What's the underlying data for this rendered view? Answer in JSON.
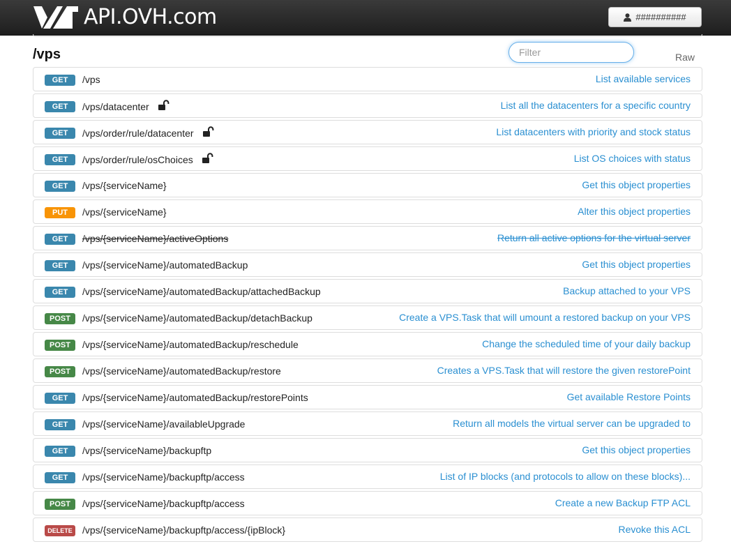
{
  "header": {
    "logo_text": "API.OVH.com",
    "user_label": "##########",
    "colors": {
      "bar": "#2b2b2b",
      "logo_text": "#ffffff"
    }
  },
  "section": {
    "title": "/vps",
    "filter_placeholder": "Filter",
    "raw_label": "Raw"
  },
  "method_colors": {
    "GET": "#3a87ad",
    "PUT": "#f89406",
    "POST": "#468847",
    "DELETE": "#b94a48"
  },
  "operations": [
    {
      "method": "GET",
      "path": "/vps",
      "description": "List available services",
      "lock": false,
      "deprecated": false
    },
    {
      "method": "GET",
      "path": "/vps/datacenter",
      "description": "List all the datacenters for a specific country",
      "lock": true,
      "deprecated": false
    },
    {
      "method": "GET",
      "path": "/vps/order/rule/datacenter",
      "description": "List datacenters with priority and stock status",
      "lock": true,
      "deprecated": false
    },
    {
      "method": "GET",
      "path": "/vps/order/rule/osChoices",
      "description": "List OS choices with status",
      "lock": true,
      "deprecated": false
    },
    {
      "method": "GET",
      "path": "/vps/{serviceName}",
      "description": "Get this object properties",
      "lock": false,
      "deprecated": false
    },
    {
      "method": "PUT",
      "path": "/vps/{serviceName}",
      "description": "Alter this object properties",
      "lock": false,
      "deprecated": false
    },
    {
      "method": "GET",
      "path": "/vps/{serviceName}/activeOptions",
      "description": "Return all active options for the virtual server",
      "lock": false,
      "deprecated": true
    },
    {
      "method": "GET",
      "path": "/vps/{serviceName}/automatedBackup",
      "description": "Get this object properties",
      "lock": false,
      "deprecated": false
    },
    {
      "method": "GET",
      "path": "/vps/{serviceName}/automatedBackup/attachedBackup",
      "description": "Backup attached to your VPS",
      "lock": false,
      "deprecated": false
    },
    {
      "method": "POST",
      "path": "/vps/{serviceName}/automatedBackup/detachBackup",
      "description": "Create a VPS.Task that will umount a restored backup on your VPS",
      "lock": false,
      "deprecated": false
    },
    {
      "method": "POST",
      "path": "/vps/{serviceName}/automatedBackup/reschedule",
      "description": "Change the scheduled time of your daily backup",
      "lock": false,
      "deprecated": false
    },
    {
      "method": "POST",
      "path": "/vps/{serviceName}/automatedBackup/restore",
      "description": "Creates a VPS.Task that will restore the given restorePoint",
      "lock": false,
      "deprecated": false
    },
    {
      "method": "GET",
      "path": "/vps/{serviceName}/automatedBackup/restorePoints",
      "description": "Get available Restore Points",
      "lock": false,
      "deprecated": false
    },
    {
      "method": "GET",
      "path": "/vps/{serviceName}/availableUpgrade",
      "description": "Return all models the virtual server can be upgraded to",
      "lock": false,
      "deprecated": false
    },
    {
      "method": "GET",
      "path": "/vps/{serviceName}/backupftp",
      "description": "Get this object properties",
      "lock": false,
      "deprecated": false
    },
    {
      "method": "GET",
      "path": "/vps/{serviceName}/backupftp/access",
      "description": "List of IP blocks (and protocols to allow on these blocks)...",
      "lock": false,
      "deprecated": false
    },
    {
      "method": "POST",
      "path": "/vps/{serviceName}/backupftp/access",
      "description": "Create a new Backup FTP ACL",
      "lock": false,
      "deprecated": false
    },
    {
      "method": "DELETE",
      "path": "/vps/{serviceName}/backupftp/access/{ipBlock}",
      "description": "Revoke this ACL",
      "lock": false,
      "deprecated": false
    }
  ]
}
